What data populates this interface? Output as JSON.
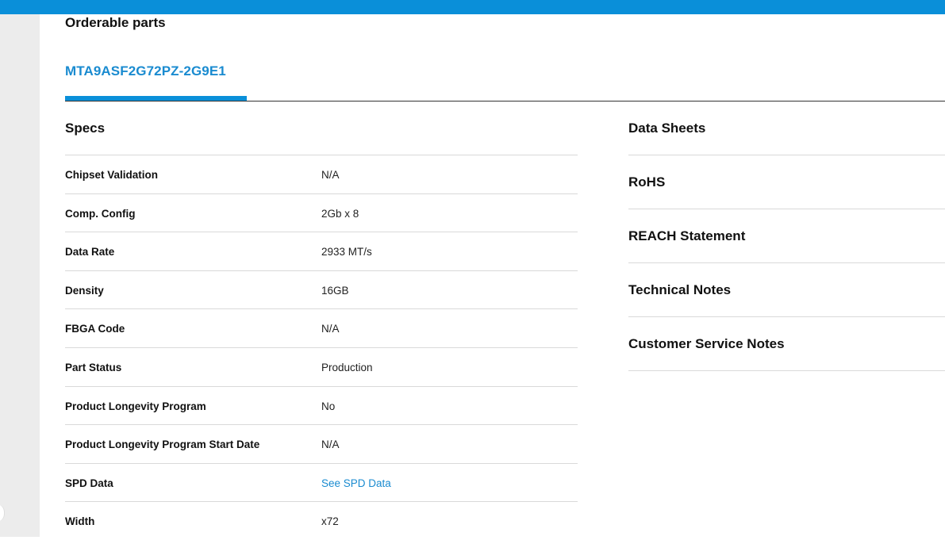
{
  "section_title": "Orderable parts",
  "tabs": [
    {
      "label": "MTA9ASF2G72PZ-2G9E1",
      "active": true
    }
  ],
  "specs": {
    "title": "Specs",
    "rows": [
      {
        "label": "Chipset Validation",
        "value": "N/A"
      },
      {
        "label": "Comp. Config",
        "value": "2Gb x 8"
      },
      {
        "label": "Data Rate",
        "value": "2933 MT/s"
      },
      {
        "label": "Density",
        "value": "16GB"
      },
      {
        "label": "FBGA Code",
        "value": "N/A"
      },
      {
        "label": "Part Status",
        "value": "Production"
      },
      {
        "label": "Product Longevity Program",
        "value": "No"
      },
      {
        "label": "Product Longevity Program Start Date",
        "value": "N/A"
      },
      {
        "label": "SPD Data",
        "value": "See SPD Data"
      },
      {
        "label": "Width",
        "value": "x72"
      }
    ]
  },
  "documents": [
    {
      "label": "Data Sheets"
    },
    {
      "label": "RoHS"
    },
    {
      "label": "REACH Statement"
    },
    {
      "label": "Technical Notes"
    },
    {
      "label": "Customer Service Notes"
    }
  ],
  "colors": {
    "accent": "#0a8fd9",
    "link": "#1a8bd0",
    "gutter": "#ececec",
    "divider": "#d9d9d9"
  }
}
